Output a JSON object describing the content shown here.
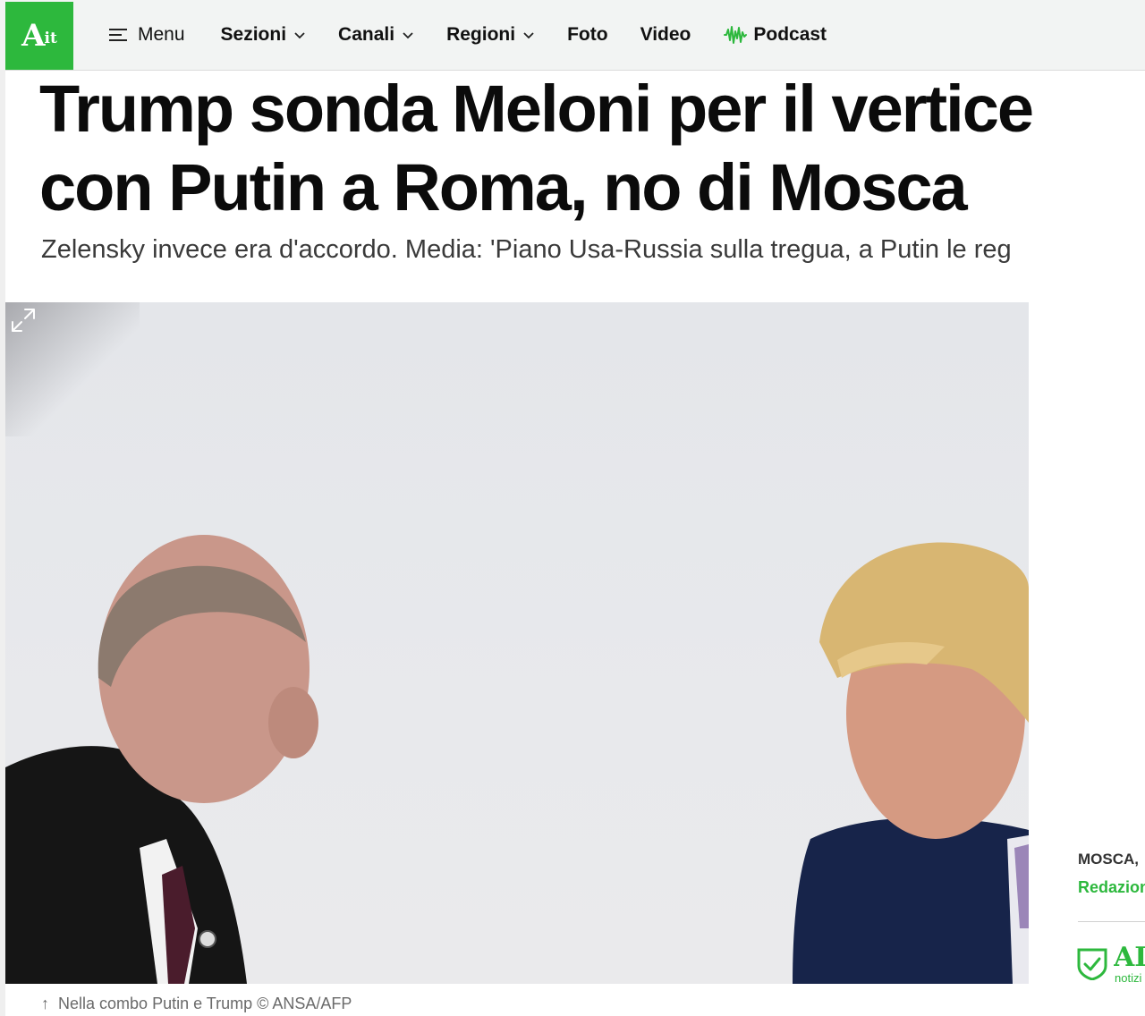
{
  "logo": {
    "letter": "A",
    "suffix": "it"
  },
  "nav": {
    "menu_label": "Menu",
    "items": [
      {
        "label": "Sezioni",
        "dropdown": true
      },
      {
        "label": "Canali",
        "dropdown": true
      },
      {
        "label": "Regioni",
        "dropdown": true
      },
      {
        "label": "Foto",
        "dropdown": false
      },
      {
        "label": "Video",
        "dropdown": false
      }
    ],
    "podcast_label": "Podcast"
  },
  "article": {
    "headline_line1": "Trump sonda Meloni per il vertice",
    "headline_line2": "con Putin a Roma, no di Mosca",
    "subtitle": "Zelensky invece era d'accordo. Media: 'Piano Usa-Russia sulla tregua, a Putin le reg",
    "caption": "Nella combo Putin e Trump © ANSA/AFP",
    "dateline": "MOSCA,",
    "author": "Redazion"
  },
  "badge": {
    "title": "AI",
    "subtitle": "notizi"
  },
  "colors": {
    "brand_green": "#2db83d",
    "nav_bg": "#f2f4f3",
    "text": "#111111"
  },
  "icons": {
    "menu": "hamburger-icon",
    "dropdown": "chevron-down-icon",
    "podcast": "soundwave-icon",
    "expand": "expand-icon",
    "caption": "arrow-up-icon",
    "badge": "shield-check-icon"
  }
}
